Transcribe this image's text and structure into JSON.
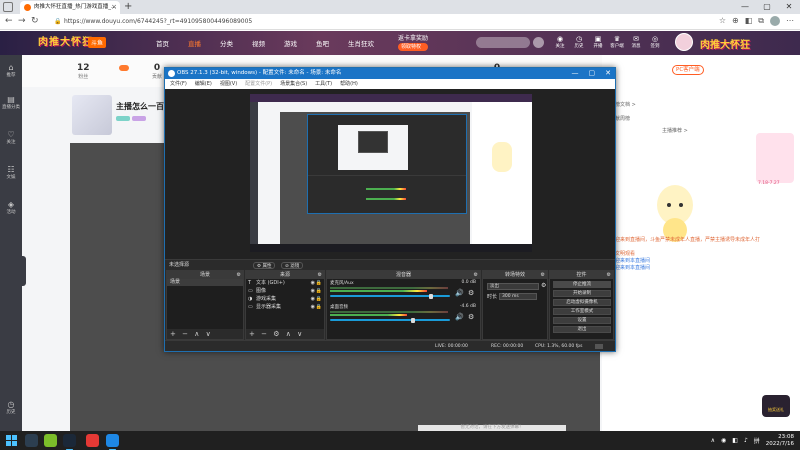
{
  "browser": {
    "tab_title": "肉推大怀狂直播_热门游戏直播_...",
    "tab_close": "×",
    "new_tab": "+",
    "url": "https://www.douyu.com/6744245?_rt=4910958004496089005",
    "window_controls": [
      "—",
      "▢",
      "✕"
    ],
    "toolbar_icons": [
      "☆",
      "⊕",
      "◧",
      "⧉",
      "☺",
      "⋯"
    ]
  },
  "site": {
    "logo": "肉推大怀狂",
    "logo_tag": "斗鱼",
    "nav": [
      "首页",
      "直播",
      "分类",
      "视频",
      "游戏",
      "鱼吧",
      "生肖狂欢"
    ],
    "nav_active": 1,
    "promo": "返卡拿奖励",
    "promo_btn": "领取特权",
    "header_icons": [
      {
        "icon": "◉",
        "label": "关注"
      },
      {
        "icon": "◷",
        "label": "历史"
      },
      {
        "icon": "▣",
        "label": "开播"
      },
      {
        "icon": "♛",
        "label": "客户端"
      },
      {
        "icon": "✉",
        "label": "消息"
      },
      {
        "icon": "◎",
        "label": "签到"
      }
    ],
    "logo_right": "肉推大怀狂",
    "rail": [
      {
        "icon": "⌂",
        "label": "推荐"
      },
      {
        "icon": "▤",
        "label": "直播分类"
      },
      {
        "icon": "♡",
        "label": "关注"
      },
      {
        "icon": "☷",
        "label": "文娱"
      },
      {
        "icon": "◈",
        "label": "活动"
      },
      {
        "icon": "◷",
        "label": "历史"
      }
    ],
    "stats": [
      {
        "value": "12",
        "label": "粉丝"
      },
      {
        "value": "0",
        "label": "贡献"
      },
      {
        "value": "0",
        "label": "热度"
      }
    ],
    "room_title": "主播怎么一百啦",
    "pc_btn": "PC客户端",
    "right_rows": [
      "上榜文档 >",
      "贡献周榜",
      "主播推荐 >"
    ],
    "heart_text": "7.18-7.27",
    "chat": [
      {
        "text": "欢迎来到直播间，斗鱼严禁未成年人直播，严禁主播诱导未成年人打赏",
        "style": "orange"
      },
      {
        "text": "请文明观看",
        "style": "orange"
      },
      {
        "text": "欢迎来到本直播间",
        "style": "blue"
      },
      {
        "text": "欢迎来到本直播间",
        "style": "blue"
      }
    ],
    "gift_text": "抽奖送礼",
    "bottom_banner": "暂无对话，请在下方发送弹幕！"
  },
  "obs": {
    "title": "OBS 27.1.3 (32-bit, windows) - 配置文件: 未命名 - 场景: 未命名",
    "window_controls": [
      "—",
      "▢",
      "✕"
    ],
    "menu": [
      "文件(F)",
      "编辑(E)",
      "视图(V)",
      "配置文件(P)",
      "场景集合(S)",
      "工具(T)",
      "帮助(H)"
    ],
    "menu_dim": [
      3
    ],
    "strip_label": "未选择源",
    "strip_btns": [
      "⚙ 属性",
      "⊘ 滤镜"
    ],
    "docks": {
      "scenes_title": "场景",
      "scenes": [
        "场景"
      ],
      "sources_title": "来源",
      "sources": [
        {
          "icon": "T",
          "name": "文本 (GDI+)"
        },
        {
          "icon": "▭",
          "name": "图像"
        },
        {
          "icon": "◑",
          "name": "游戏采集"
        },
        {
          "icon": "▭",
          "name": "显示器采集"
        }
      ],
      "source_vis": "◉",
      "source_lock": "🔒",
      "mixer_title": "混音器",
      "mixer": [
        {
          "name": "麦克风/Aux",
          "db": "0.0 dB",
          "level": 0.82,
          "fader": 0.85
        },
        {
          "name": "桌面音频",
          "db": "-4.6 dB",
          "level": 0.65,
          "fader": 0.7
        }
      ],
      "transitions_title": "转场特效",
      "transition": "淡出",
      "duration_label": "时长",
      "duration": "300 ms",
      "controls_title": "控件",
      "controls": [
        "停止推流",
        "开始录制",
        "启动虚拟摄像机",
        "工作室模式",
        "设置",
        "退出"
      ]
    },
    "dock_icon": "⚙",
    "footer_scene": [
      "+",
      "−",
      "∧",
      "∨"
    ],
    "footer_src": [
      "+",
      "−",
      "⚙",
      "∧",
      "∨"
    ],
    "mute_icon": "🔊",
    "status": {
      "live": "LIVE: 00:00:00",
      "rec": "REC: 00:00:00",
      "cpu": "CPU: 1.3%, 60.00 fps"
    }
  },
  "taskbar": {
    "time": "23:08",
    "date": "2022/7/16",
    "tray": [
      "∧",
      "◉",
      "◧",
      "♪",
      "拼"
    ]
  },
  "colors": {
    "obs_accent": "#1b74c6",
    "douyu_orange": "#ff5d23",
    "meter_green": "#4caf50"
  }
}
